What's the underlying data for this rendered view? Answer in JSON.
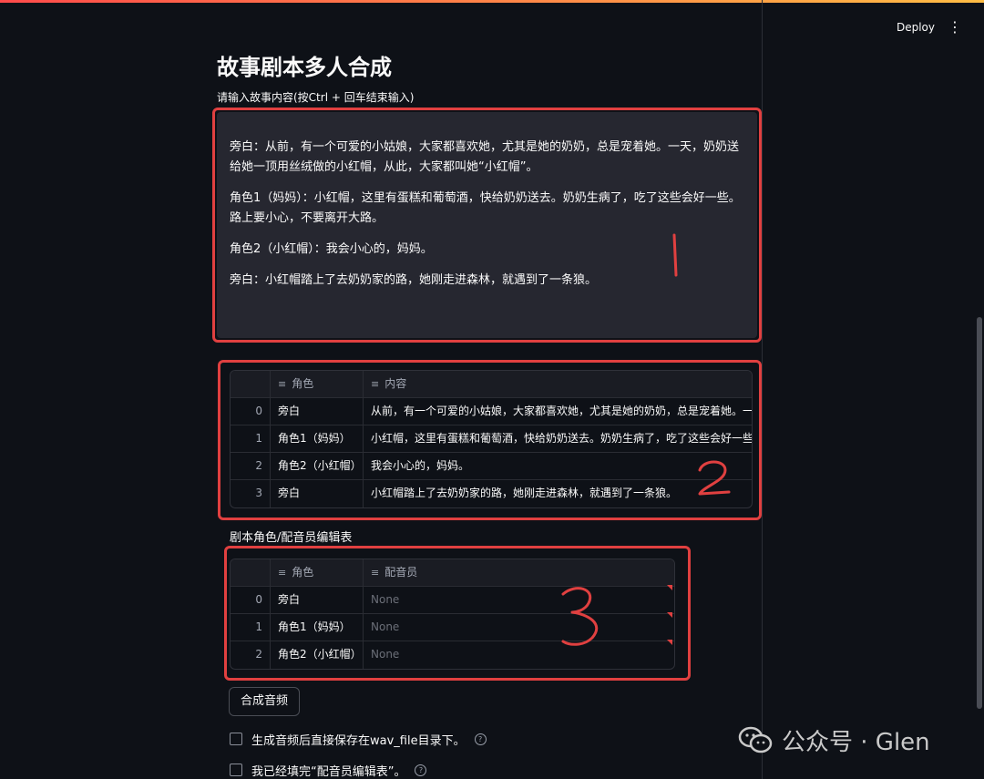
{
  "header": {
    "deploy_label": "Deploy",
    "menu_icon": "⋮"
  },
  "page": {
    "title": "故事剧本多人合成",
    "input_label": "请输入故事内容(按Ctrl + 回车结束输入)"
  },
  "story": {
    "paragraphs": [
      "旁白：从前，有一个可爱的小姑娘，大家都喜欢她，尤其是她的奶奶，总是宠着她。一天，奶奶送给她一顶用丝绒做的小红帽，从此，大家都叫她“小红帽”。",
      "角色1（妈妈）：小红帽，这里有蛋糕和葡萄酒，快给奶奶送去。奶奶生病了，吃了这些会好一些。路上要小心，不要离开大路。",
      "角色2（小红帽）：我会小心的，妈妈。",
      "旁白：小红帽踏上了去奶奶家的路，她刚走进森林，就遇到了一条狼。"
    ]
  },
  "script_table": {
    "columns": [
      "角色",
      "内容"
    ],
    "rows": [
      {
        "index": "0",
        "role": "旁白",
        "content": "从前，有一个可爱的小姑娘，大家都喜欢她，尤其是她的奶奶，总是宠着她。一"
      },
      {
        "index": "1",
        "role": "角色1（妈妈）",
        "content": "小红帽，这里有蛋糕和葡萄酒，快给奶奶送去。奶奶生病了，吃了这些会好一些"
      },
      {
        "index": "2",
        "role": "角色2（小红帽）",
        "content": "我会小心的，妈妈。"
      },
      {
        "index": "3",
        "role": "旁白",
        "content": "小红帽踏上了去奶奶家的路，她刚走进森林，就遇到了一条狼。"
      }
    ]
  },
  "voice_table": {
    "label": "剧本角色/配音员编辑表",
    "columns": [
      "角色",
      "配音员"
    ],
    "rows": [
      {
        "index": "0",
        "role": "旁白",
        "voice": "None"
      },
      {
        "index": "1",
        "role": "角色1（妈妈）",
        "voice": "None"
      },
      {
        "index": "2",
        "role": "角色2（小红帽）",
        "voice": "None"
      }
    ]
  },
  "actions": {
    "synthesize_label": "合成音频"
  },
  "checkboxes": [
    {
      "label": "生成音频后直接保存在wav_file目录下。",
      "checked": false
    },
    {
      "label": "我已经填完“配音员编辑表”。",
      "checked": false
    }
  ],
  "annotations": {
    "one": "1",
    "two": "2",
    "three": "3"
  },
  "watermark": {
    "text": "公众号 · Glen"
  },
  "colors": {
    "background": "#0e1117",
    "input_bg": "#262730",
    "annotation_red": "#e04040",
    "accent_bar": "#ff4b4b"
  }
}
